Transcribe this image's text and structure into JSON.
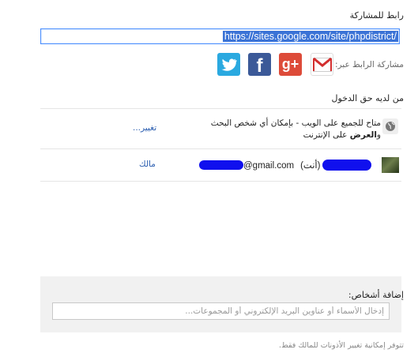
{
  "share": {
    "label": "رابط للمشاركة",
    "url": "https://sites.google.com/site/phpdistrict/",
    "share_via_label": "مشاركة الرابط عبر:"
  },
  "icons": {
    "gmail": "gmail-icon",
    "google_plus": "google-plus-icon",
    "google_plus_text": "g+",
    "facebook": "facebook-icon",
    "facebook_text": "f",
    "twitter": "twitter-icon"
  },
  "access": {
    "label": "من لديه حق الدخول",
    "rows": [
      {
        "description_before": "متاح للجميع على الويب - بإمكان أي شخص البحث و",
        "description_bold": "العرض",
        "description_after": " على الإنترنت",
        "action": "تغيير..."
      },
      {
        "email_suffix": "@gmail.com",
        "you_tag": "(أنت)",
        "role": "مالك"
      }
    ]
  },
  "add_people": {
    "label": "إضافة أشخاص:",
    "placeholder": "إدخال الأسماء أو عناوين البريد الإلكتروني أو المجموعات..."
  },
  "footer_note": "تتوفر إمكانية تغيير الأذونات للمالك فقط.",
  "colors": {
    "link": "#2a5db0",
    "selection": "#3b73d6",
    "focus_border": "#4d90fe",
    "redaction": "#1010ee"
  }
}
